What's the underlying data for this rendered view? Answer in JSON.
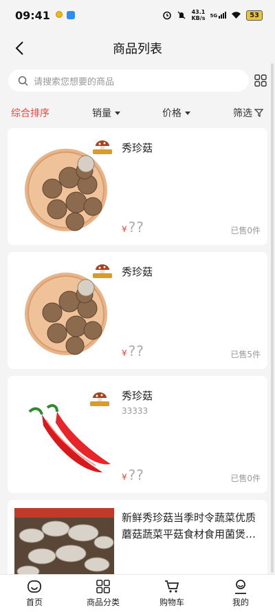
{
  "status": {
    "time": "09:41",
    "net_speed_top": "43.1",
    "net_speed_bottom": "KB/s",
    "network": "5G",
    "battery": "53"
  },
  "nav": {
    "title": "商品列表"
  },
  "search": {
    "placeholder": "请搜索您想要的商品"
  },
  "sort": {
    "comprehensive": "综合排序",
    "sales": "销量",
    "price": "价格",
    "filter": "筛选"
  },
  "products": [
    {
      "name": "秀珍菇",
      "desc": "",
      "price_symbol": "¥",
      "price": "??",
      "sold": "已售0件",
      "image": "mushroom-plate"
    },
    {
      "name": "秀珍菇",
      "desc": "",
      "price_symbol": "¥",
      "price": "??",
      "sold": "已售5件",
      "image": "mushroom-plate"
    },
    {
      "name": "秀珍菇",
      "desc": "33333",
      "price_symbol": "¥",
      "price": "??",
      "sold": "已售0件",
      "image": "red-chili"
    },
    {
      "name": "新鲜秀珍菇当季时令蔬菜优质蘑菇蔬菜平菇食材食用菌煲…",
      "desc": "",
      "price_symbol": "",
      "price": "",
      "sold": "",
      "image": "oyster-mushrooms"
    }
  ],
  "tabs": [
    {
      "label": "首页",
      "icon": "home-icon"
    },
    {
      "label": "商品分类",
      "icon": "category-icon"
    },
    {
      "label": "购物车",
      "icon": "cart-icon"
    },
    {
      "label": "我的",
      "icon": "profile-icon"
    }
  ],
  "colors": {
    "accent": "#e8473c",
    "background": "#f4f4f4",
    "card": "#ffffff"
  }
}
